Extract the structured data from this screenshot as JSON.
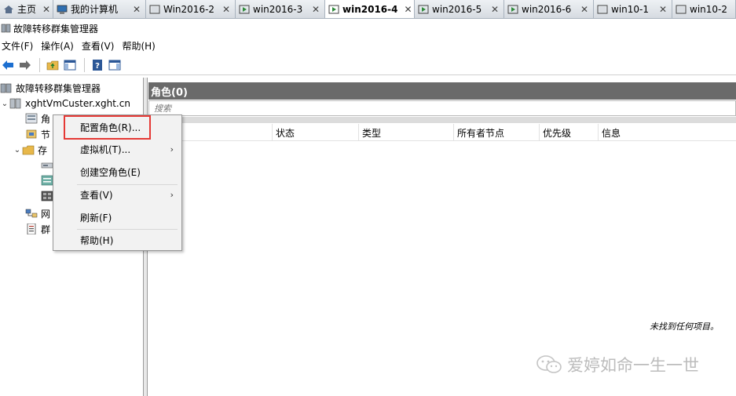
{
  "tabs": [
    {
      "label": "主页",
      "icon": "home-icon"
    },
    {
      "label": "我的计算机",
      "icon": "computer-icon"
    },
    {
      "label": "Win2016-2",
      "icon": "vm-icon"
    },
    {
      "label": "win2016-3",
      "icon": "vm-running-icon"
    },
    {
      "label": "win2016-4",
      "icon": "vm-running-icon",
      "active": true
    },
    {
      "label": "win2016-5",
      "icon": "vm-running-icon"
    },
    {
      "label": "win2016-6",
      "icon": "vm-running-icon"
    },
    {
      "label": "win10-1",
      "icon": "vm-icon"
    },
    {
      "label": "win10-2",
      "icon": "vm-icon"
    }
  ],
  "window": {
    "title": "故障转移群集管理器"
  },
  "menubar": [
    "文件(F)",
    "操作(A)",
    "查看(V)",
    "帮助(H)"
  ],
  "tree": {
    "root": "故障转移群集管理器",
    "cluster": "xghtVmCuster.xght.cn",
    "items": [
      "角",
      "节",
      "存",
      "网",
      "群"
    ]
  },
  "roles_pane": {
    "header": "角色(0)",
    "search_placeholder": "搜索",
    "columns": [
      "状态",
      "类型",
      "所有者节点",
      "优先级",
      "信息"
    ],
    "empty_message": "未找到任何项目。"
  },
  "context_menu": {
    "items": [
      {
        "label": "配置角色(R)...",
        "submenu": false
      },
      {
        "label": "虚拟机(T)...",
        "submenu": true
      },
      {
        "label": "创建空角色(E)",
        "submenu": false
      },
      {
        "label": "查看(V)",
        "submenu": true
      },
      {
        "label": "刷新(F)",
        "submenu": false
      },
      {
        "label": "帮助(H)",
        "submenu": false
      }
    ],
    "highlight_color": "#e53935"
  },
  "watermark": {
    "text": "爱婷如命一生一世"
  }
}
